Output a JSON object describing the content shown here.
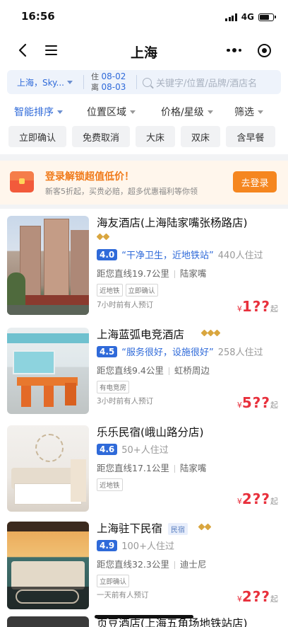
{
  "status": {
    "time": "16:56",
    "network": "4G"
  },
  "nav": {
    "title": "上海"
  },
  "search": {
    "city": "上海，Sky...",
    "checkin_label": "住",
    "checkin": "08-02",
    "checkout_label": "离",
    "checkout": "08-03",
    "placeholder": "关键字/位置/品牌/酒店名"
  },
  "filters": [
    "智能排序",
    "位置区域",
    "价格/星级",
    "筛选"
  ],
  "quick_tags": [
    "立即确认",
    "免费取消",
    "大床",
    "双床",
    "含早餐"
  ],
  "promo": {
    "title": "登录解锁超值低价！",
    "subtitle": "新客5折起，买贵必赔，超多优惠福利等你领",
    "button": "去登录"
  },
  "hotels": [
    {
      "name": "海友酒店(上海陆家嘴张杨路店)",
      "name_line2": "",
      "diamonds": 2,
      "score": "4.0",
      "quote": "“干净卫生，近地铁站”",
      "stays": "440人住过",
      "distance": "距您直线19.7公里",
      "area": "陆家嘴",
      "tags": [
        "近地铁",
        "立即确认"
      ],
      "booked": "7小时前有人预订",
      "price": "1??",
      "currency": "¥",
      "suffix": "起"
    },
    {
      "name": "上海蓝弧电竞酒店",
      "diamonds": 3,
      "score": "4.5",
      "quote": "“服务很好，设施很好”",
      "stays": "258人住过",
      "distance": "距您直线9.4公里",
      "area": "虹桥周边",
      "tags": [
        "有电竞房"
      ],
      "booked": "3小时前有人预订",
      "price": "5??",
      "currency": "¥",
      "suffix": "起"
    },
    {
      "name": "乐乐民宿(峨山路分店)",
      "score": "4.6",
      "stays": "50+人住过",
      "distance": "距您直线17.1公里",
      "area": "陆家嘴",
      "tags": [
        "近地铁"
      ],
      "price": "2??",
      "currency": "¥",
      "suffix": "起"
    },
    {
      "name": "上海驻下民宿",
      "badge": "民宿",
      "diamonds": 2,
      "score": "4.9",
      "stays": "100+人住过",
      "distance": "距您直线32.3公里",
      "area": "迪士尼",
      "tags": [
        "立即确认"
      ],
      "booked": "一天前有人预订",
      "price": "2??",
      "currency": "¥",
      "suffix": "起"
    },
    {
      "name": "页豆酒店(上海五角场地铁站店)"
    }
  ]
}
